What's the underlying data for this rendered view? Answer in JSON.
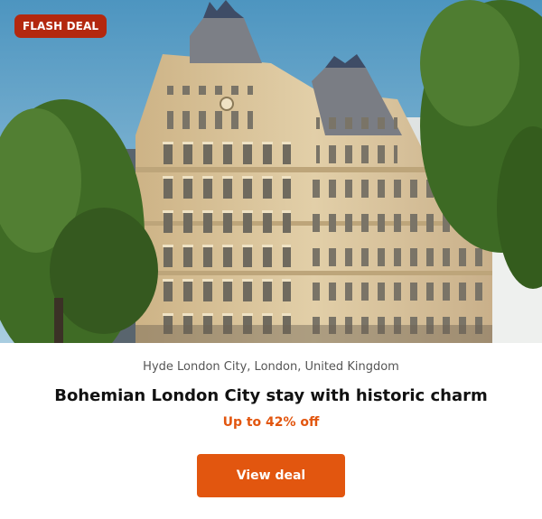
{
  "badge": {
    "label": "FLASH DEAL"
  },
  "deal": {
    "location": "Hyde London City, London, United Kingdom",
    "title": "Bohemian London City stay with historic charm",
    "discount": "Up to 42% off",
    "cta_label": "View deal"
  },
  "colors": {
    "accent": "#e2560f",
    "badge_bg": "#b3280f",
    "sky": "#5a9ec4",
    "stone": "#d8c29a",
    "tree": "#3f6b25"
  },
  "hero_image": {
    "subject": "historic-hotel-building"
  }
}
